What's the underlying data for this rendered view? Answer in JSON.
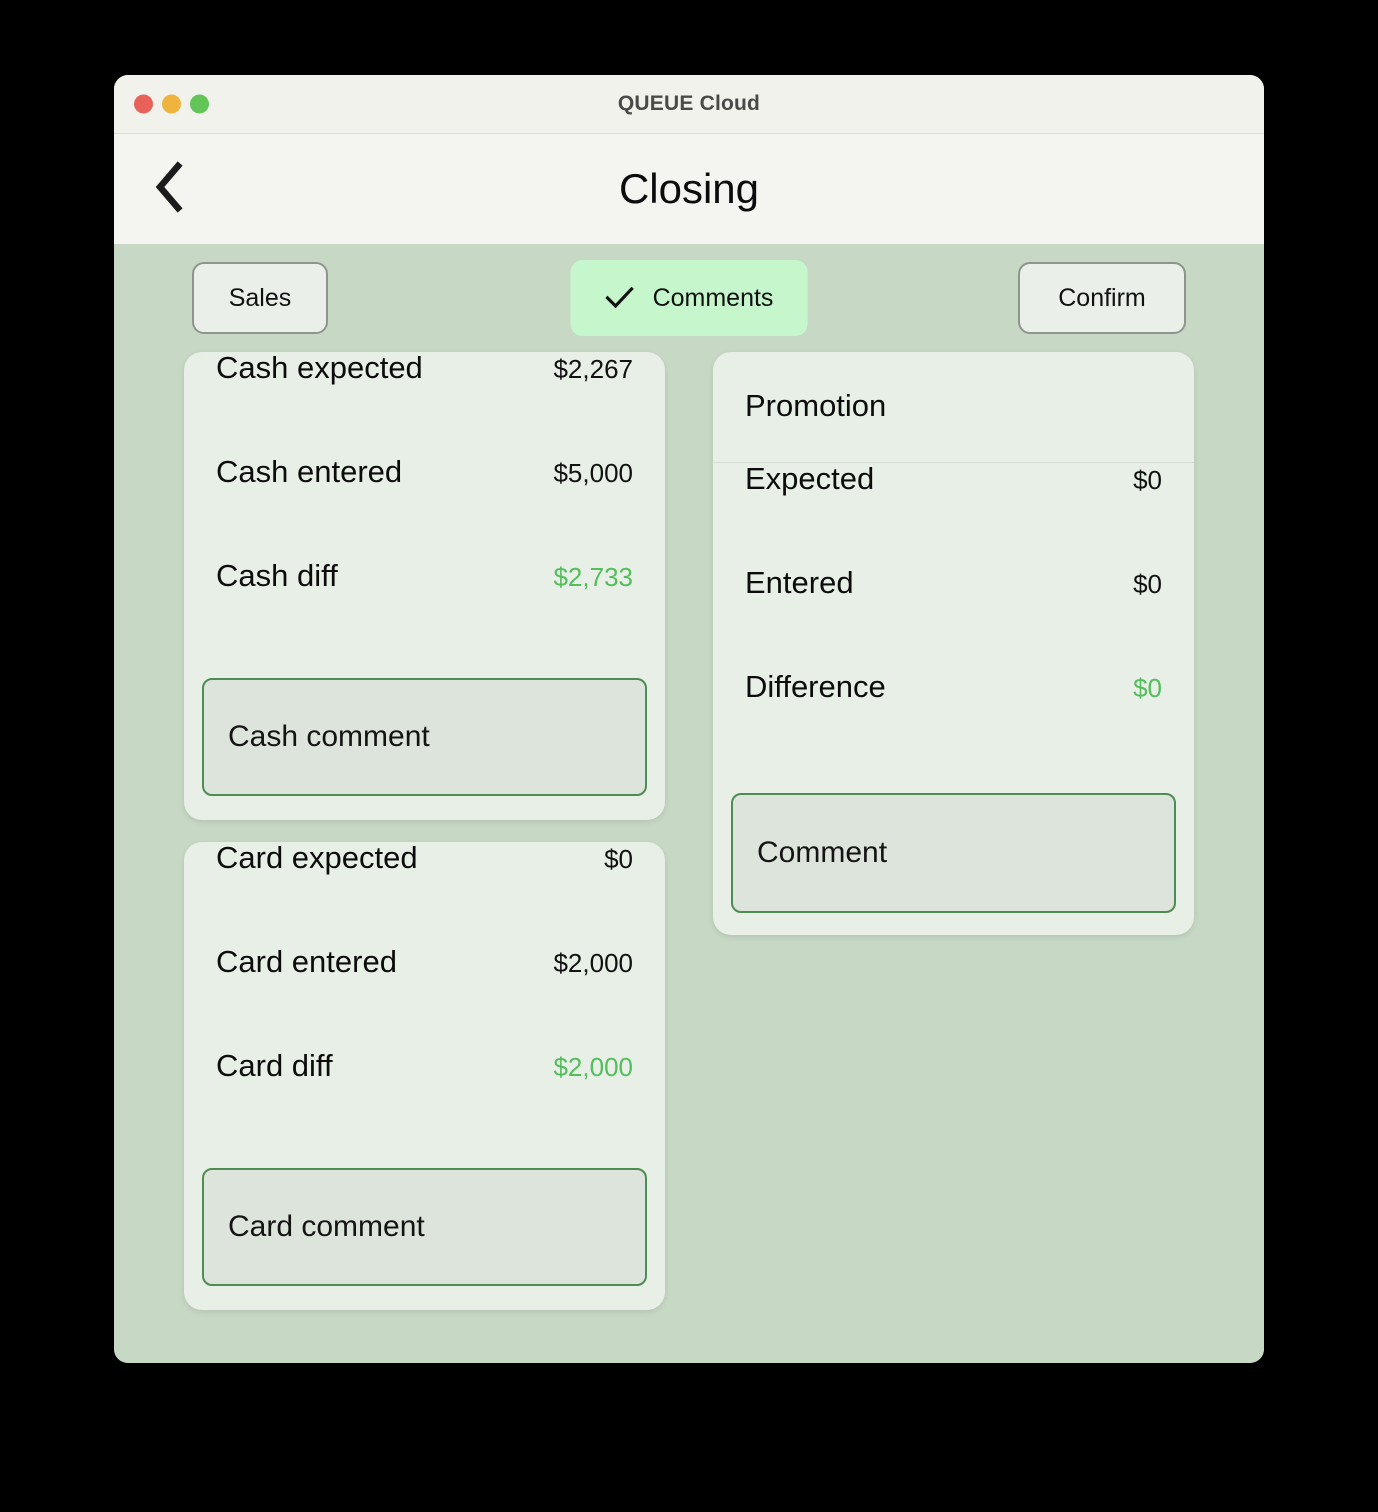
{
  "window": {
    "title": "QUEUE Cloud",
    "traffic_lights": [
      "close",
      "minimize",
      "zoom"
    ]
  },
  "header": {
    "back_icon": "chevron-left-icon",
    "page_title": "Closing"
  },
  "toolbar": {
    "sales_label": "Sales",
    "comments_label": "Comments",
    "comments_check_icon": "check-icon",
    "comments_active": true,
    "confirm_label": "Confirm"
  },
  "cash_card": {
    "rows": [
      {
        "label": "Cash expected",
        "value": "$2,267",
        "positive": false
      },
      {
        "label": "Cash entered",
        "value": "$5,000",
        "positive": false
      },
      {
        "label": "Cash diff",
        "value": "$2,733",
        "positive": true
      }
    ],
    "comment_placeholder": "Cash comment"
  },
  "card_card": {
    "rows": [
      {
        "label": "Card expected",
        "value": "$0",
        "positive": false
      },
      {
        "label": "Card entered",
        "value": "$2,000",
        "positive": false
      },
      {
        "label": "Card diff",
        "value": "$2,000",
        "positive": true
      }
    ],
    "comment_placeholder": "Card comment"
  },
  "promotion_card": {
    "header": "Promotion",
    "rows": [
      {
        "label": "Expected",
        "value": "$0",
        "positive": false
      },
      {
        "label": "Entered",
        "value": "$0",
        "positive": false
      },
      {
        "label": "Difference",
        "value": "$0",
        "positive": true
      }
    ],
    "comment_placeholder": "Comment"
  },
  "colors": {
    "app_background": "#c7d9c5",
    "card_background": "#e8efe7",
    "titlebar": "#f2f2ed",
    "header": "#f4f5f1",
    "accent_green": "#54bd5c",
    "toggle_active": "#c6f6cb",
    "comment_border": "#4f8c51",
    "comment_fill": "#dde4db"
  }
}
